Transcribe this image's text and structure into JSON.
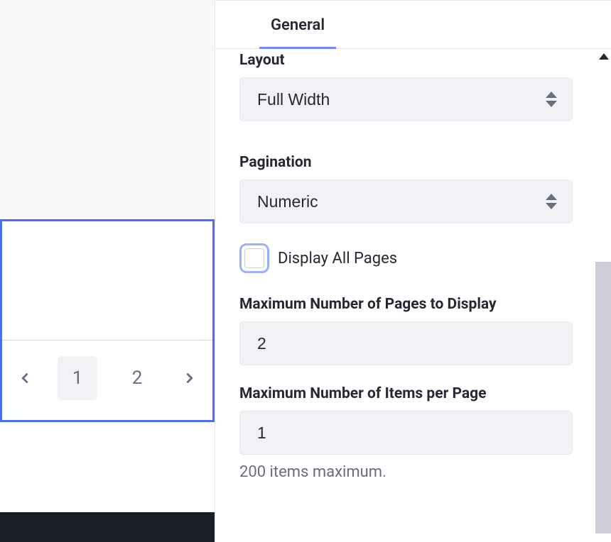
{
  "tabs": {
    "general": "General"
  },
  "settings": {
    "layout": {
      "label": "Layout",
      "value": "Full Width"
    },
    "pagination": {
      "label": "Pagination",
      "value": "Numeric"
    },
    "displayAllPages": {
      "label": "Display All Pages"
    },
    "maxPages": {
      "label": "Maximum Number of Pages to Display",
      "value": "2"
    },
    "maxItems": {
      "label": "Maximum Number of Items per Page",
      "value": "1",
      "helper": "200 items maximum."
    }
  },
  "preview": {
    "pages": [
      "1",
      "2"
    ]
  }
}
